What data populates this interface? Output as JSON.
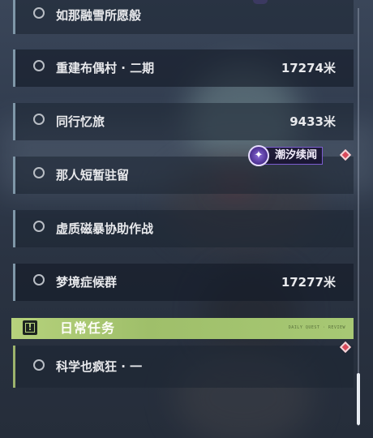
{
  "quests": [
    {
      "title": "如那融雪所愿般",
      "distance": ""
    },
    {
      "title": "重建布偶村 · 二期",
      "distance": "17274米"
    },
    {
      "title": "同行忆旅",
      "distance": "9433米"
    },
    {
      "title": "那人短暂驻留",
      "distance": ""
    },
    {
      "title": "虚质磁暴协助作战",
      "distance": ""
    },
    {
      "title": "梦境症候群",
      "distance": "17277米"
    }
  ],
  "daily": {
    "header": "日常任务",
    "icon": "!",
    "deco": "DAILY QUEST · REVIEW",
    "items": [
      {
        "title": "科学也疯狂 · 一",
        "distance": ""
      }
    ]
  },
  "tide": {
    "label": "潮汐续闻",
    "icon": "tide-emblem-icon"
  },
  "colors": {
    "accent_green": "#b6d27c",
    "accent_purple": "#7c5dd0",
    "pin_red": "#d84a5c"
  }
}
